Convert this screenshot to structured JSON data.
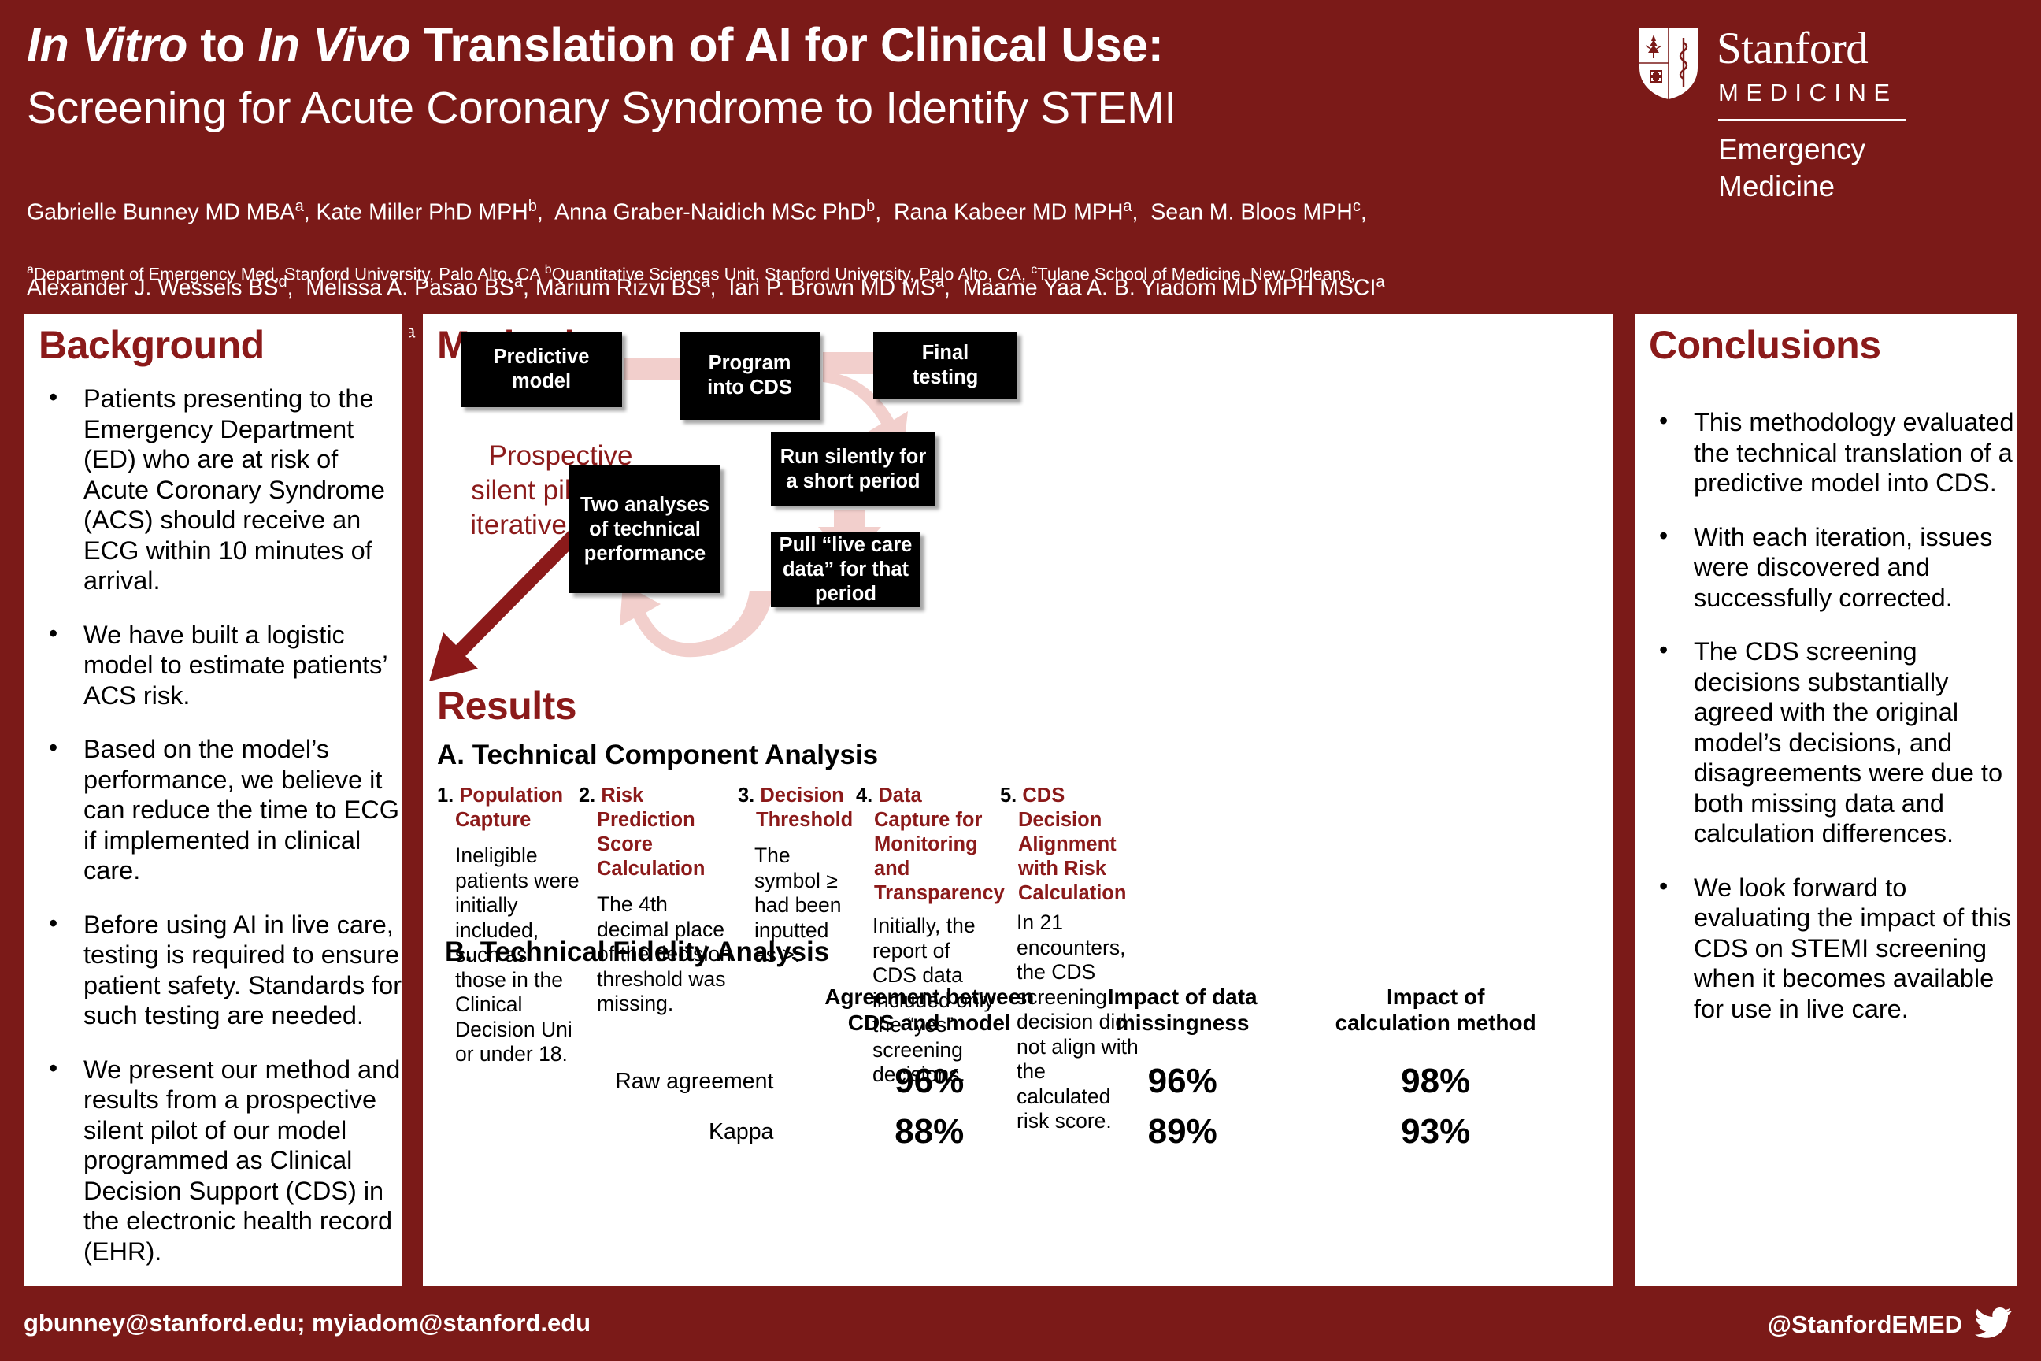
{
  "header": {
    "title_line1_pre": "In Vitro",
    "title_line1_mid": " to ",
    "title_line1_em2": "In Vivo",
    "title_line1_post": " Translation of AI for Clinical Use:",
    "title_line2": "Screening for Acute Coronary Syndrome to Identify STEMI",
    "authors": "Gabrielle Bunney MD MBAa, Kate Miller PhD MPHb,  Anna Graber-Naidich MSc PhDb,  Rana Kabeer MD MPHa,  Sean M. Bloos MPHc,\nAlexander J. Wessels BSd,  Melissa A. Pasao BSa, Marium Rizvi BSa,  Ian P. Brown MD MSa,  Maame Yaa A. B. Yiadom MD MPH MSCIa",
    "affiliations": "aDepartment of Emergency Med, Stanford University, Palo Alto, CA bQuantitative Sciences Unit, Stanford University, Palo Alto, CA, cTulane School of Medicine, New Orleans,\nLA, dTechnology and Data Solutions, Stanford Healthcare, Palo Alto, CA",
    "logo": {
      "wordmark": "Stanford",
      "subwordmark": "MEDICINE",
      "department": "Emergency\nMedicine"
    }
  },
  "background": {
    "heading": "Background",
    "bullets": [
      "Patients presenting to the Emergency Department (ED) who are at risk of Acute Coronary Syndrome (ACS) should receive an ECG within 10 minutes of arrival.",
      "We have built a logistic model to estimate patients’ ACS risk.",
      "Based on the model’s performance, we believe it can reduce the time to ECG if implemented in clinical care.",
      "Before using AI in live care, testing is required to ensure patient safety. Standards for such testing are needed.",
      "We present our method and results from a prospective silent pilot of our model programmed as Clinical Decision Support (CDS) in the electronic health record (EHR)."
    ]
  },
  "methods": {
    "heading": "Methods",
    "side_label": "Prospective\nsilent pilot with\niterative cycles",
    "flow_boxes": {
      "predictive_model": "Predictive\nmodel",
      "program_into_cds": "Program\ninto CDS",
      "final_testing": "Final\ntesting",
      "run_silently": "Run silently for\na short period",
      "pull_live_care": "Pull “live care\ndata” for that\nperiod",
      "two_analyses": "Two analyses\nof technical\nperformance"
    }
  },
  "results": {
    "heading": "Results",
    "section_a_heading": "A. Technical Component Analysis",
    "section_b_heading": "B. Technical Fidelity Analysis",
    "components": [
      {
        "num": "1.",
        "title": "Population Capture",
        "body": "Ineligible patients were initially included, such as those in the Clinical Decision Uni or under 18."
      },
      {
        "num": "2.",
        "title": "Risk Prediction Score Calculation",
        "body": "The 4th decimal place of the decision threshold was missing."
      },
      {
        "num": "3.",
        "title": "Decision Threshold",
        "body": "The symbol ≥ had been inputted as >."
      },
      {
        "num": "4.",
        "title": "Data Capture for Monitoring and Transparency",
        "body": "Initially, the report of CDS data included only the “yes” screening decisions."
      },
      {
        "num": "5.",
        "title": "CDS Decision Alignment with Risk Calculation",
        "body": "In 21 encounters, the CDS screening decision did not align with the calculated risk score."
      }
    ]
  },
  "chart_data": {
    "type": "table",
    "title": "B. Technical Fidelity Analysis",
    "columns": [
      "Agreement between\nCDS and model",
      "Impact of data\nmissingness",
      "Impact of\ncalculation method"
    ],
    "rows": [
      {
        "label": "Raw agreement",
        "values": [
          "96%",
          "96%",
          "98%"
        ]
      },
      {
        "label": "Kappa",
        "values": [
          "88%",
          "89%",
          "93%"
        ]
      }
    ]
  },
  "conclusions": {
    "heading": "Conclusions",
    "bullets": [
      "This methodology evaluated the technical translation of a predictive model into CDS.",
      "With each iteration, issues were discovered and successfully corrected.",
      "The CDS screening decisions substantially agreed with the original model’s decisions, and disagreements were due to both missing data and calculation differences.",
      "We look forward to evaluating the impact of this CDS on STEMI screening when it becomes available for use in live care."
    ]
  },
  "footer": {
    "emails": "gbunney@stanford.edu; myiadom@stanford.edu",
    "handle": "@StanfordEMED"
  },
  "colors": {
    "brand_maroon": "#7b1a18",
    "heading_red": "#8b1a1a",
    "arrow_pink": "#f2cfcc",
    "box_black": "#000000"
  }
}
